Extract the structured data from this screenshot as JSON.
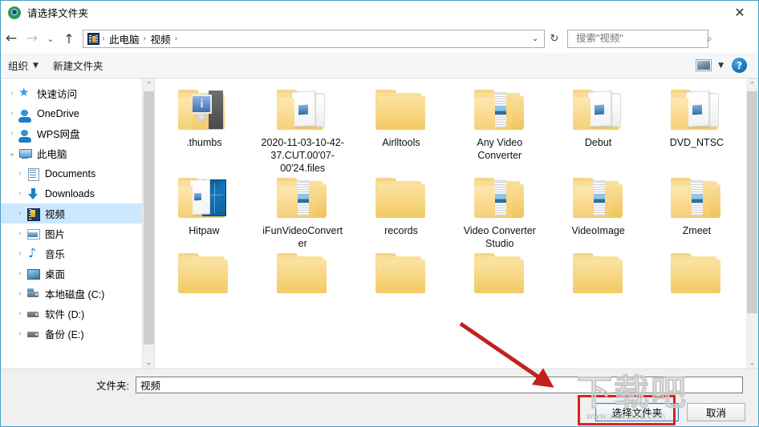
{
  "window": {
    "title": "请选择文件夹",
    "app_icon": "camera-icon",
    "close_label": "✕"
  },
  "address_bar": {
    "back_icon": "←",
    "forward_icon": "→",
    "recent_icon": "⌄",
    "up_icon": "↑",
    "location_icon": "video-folder-icon",
    "crumbs": [
      "此电脑",
      "视频"
    ],
    "separator": "›",
    "dropdown_icon": "⌄",
    "refresh_icon": "↻",
    "search_placeholder": "搜索\"视频\"",
    "search_value": "",
    "search_icon": "⌕"
  },
  "toolbar": {
    "organize_label": "组织",
    "organize_caret": "▼",
    "new_folder_label": "新建文件夹",
    "view_icon": "view-mode-icon",
    "view_caret": "▼",
    "help_label": "?"
  },
  "sidebar": {
    "items": [
      {
        "label": "快速访问",
        "icon": "star-icon",
        "chevron": "›",
        "indent": 0,
        "selected": false,
        "expanded": false
      },
      {
        "label": "OneDrive",
        "icon": "cloud-icon",
        "chevron": "›",
        "indent": 0,
        "selected": false,
        "expanded": false
      },
      {
        "label": "WPS网盘",
        "icon": "cloud-icon",
        "chevron": "›",
        "indent": 0,
        "selected": false,
        "expanded": false
      },
      {
        "label": "此电脑",
        "icon": "computer-icon",
        "chevron": "⌄",
        "indent": 0,
        "selected": false,
        "expanded": true
      },
      {
        "label": "Documents",
        "icon": "documents-icon",
        "chevron": "›",
        "indent": 1,
        "selected": false,
        "expanded": false
      },
      {
        "label": "Downloads",
        "icon": "downloads-icon",
        "chevron": "›",
        "indent": 1,
        "selected": false,
        "expanded": false
      },
      {
        "label": "视频",
        "icon": "videos-icon",
        "chevron": "›",
        "indent": 1,
        "selected": true,
        "expanded": false
      },
      {
        "label": "图片",
        "icon": "pictures-icon",
        "chevron": "›",
        "indent": 1,
        "selected": false,
        "expanded": false
      },
      {
        "label": "音乐",
        "icon": "music-icon",
        "chevron": "›",
        "indent": 1,
        "selected": false,
        "expanded": false
      },
      {
        "label": "桌面",
        "icon": "desktop-icon",
        "chevron": "›",
        "indent": 1,
        "selected": false,
        "expanded": false
      },
      {
        "label": "本地磁盘 (C:)",
        "icon": "system-drive-icon",
        "chevron": "›",
        "indent": 1,
        "selected": false,
        "expanded": false
      },
      {
        "label": "软件 (D:)",
        "icon": "drive-icon",
        "chevron": "›",
        "indent": 1,
        "selected": false,
        "expanded": false
      },
      {
        "label": "备份 (E:)",
        "icon": "drive-icon",
        "chevron": "›",
        "indent": 1,
        "selected": false,
        "expanded": false
      }
    ],
    "scroll_up_icon": "⌃",
    "scroll_down_icon": "⌄"
  },
  "files": {
    "items": [
      {
        "name": ".thumbs",
        "icon": "folder-monitor-thumbnail"
      },
      {
        "name": "2020-11-03-10-42-37.CUT.00'07-00'24.files",
        "icon": "folder-document-sheet"
      },
      {
        "name": "Airlltools",
        "icon": "folder-plain"
      },
      {
        "name": "Any Video Converter",
        "icon": "folder-filmstrip"
      },
      {
        "name": "Debut",
        "icon": "folder-document-sheet"
      },
      {
        "name": "DVD_NTSC",
        "icon": "folder-document-sheet"
      },
      {
        "name": "Hitpaw",
        "icon": "folder-windows-preview"
      },
      {
        "name": "iFunVideoConverter",
        "icon": "folder-filmstrip"
      },
      {
        "name": "records",
        "icon": "folder-plain"
      },
      {
        "name": "Video Converter Studio",
        "icon": "folder-filmstrip"
      },
      {
        "name": "VideoImage",
        "icon": "folder-filmstrip"
      },
      {
        "name": "Zmeet",
        "icon": "folder-filmstrip"
      }
    ],
    "partial_row_icon": "folder-plain",
    "partial_row_count": 6,
    "scroll_up_icon": "⌃",
    "scroll_down_icon": "⌄"
  },
  "footer": {
    "folder_label": "文件夹:",
    "folder_value": "视频",
    "select_button": "选择文件夹",
    "cancel_button": "取消"
  },
  "annotations": {
    "highlight_color": "#e02020",
    "arrow_color": "#c4201c"
  },
  "watermark": {
    "big_text": "下载吧",
    "url": "www.xiazaiba.com"
  }
}
